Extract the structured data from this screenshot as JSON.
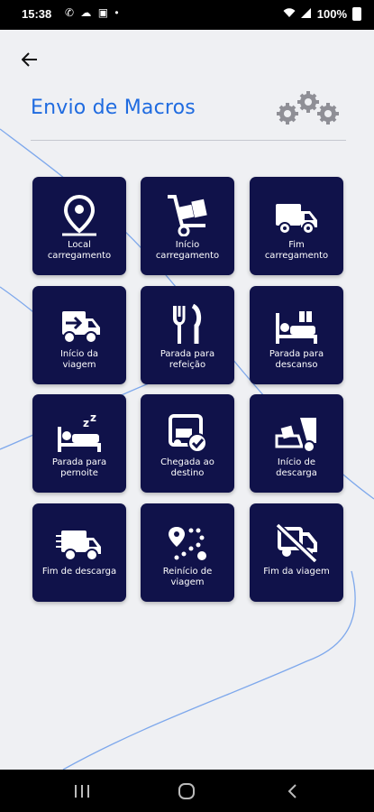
{
  "status_bar": {
    "time": "15:38",
    "left_icons": "✆ ☁ ▣ •",
    "battery": "100%"
  },
  "header": {
    "title": "Envio de Macros"
  },
  "tiles": [
    {
      "label": "Local\ncarregamento",
      "icon": "location-pin-icon"
    },
    {
      "label": "Início\ncarregamento",
      "icon": "hand-truck-icon"
    },
    {
      "label": "Fim\ncarregamento",
      "icon": "delivery-truck-icon"
    },
    {
      "label": "Início da\nviagem",
      "icon": "fast-truck-icon"
    },
    {
      "label": "Parada para\nrefeição",
      "icon": "fork-knife-icon"
    },
    {
      "label": "Parada para\ndescanso",
      "icon": "rest-bed-icon"
    },
    {
      "label": "Parada para\npernoite",
      "icon": "sleep-bed-icon"
    },
    {
      "label": "Chegada ao\ndestino",
      "icon": "arrival-truck-check-icon"
    },
    {
      "label": "Início de\ndescarga",
      "icon": "unloading-icon"
    },
    {
      "label": "Fim de descarga",
      "icon": "truck-icon"
    },
    {
      "label": "Reinício de\nviagem",
      "icon": "route-icon"
    },
    {
      "label": "Fim da viagem",
      "icon": "truck-off-icon"
    }
  ],
  "colors": {
    "accent": "#1f6be0",
    "tile": "#10124a",
    "background": "#eff0f3"
  }
}
